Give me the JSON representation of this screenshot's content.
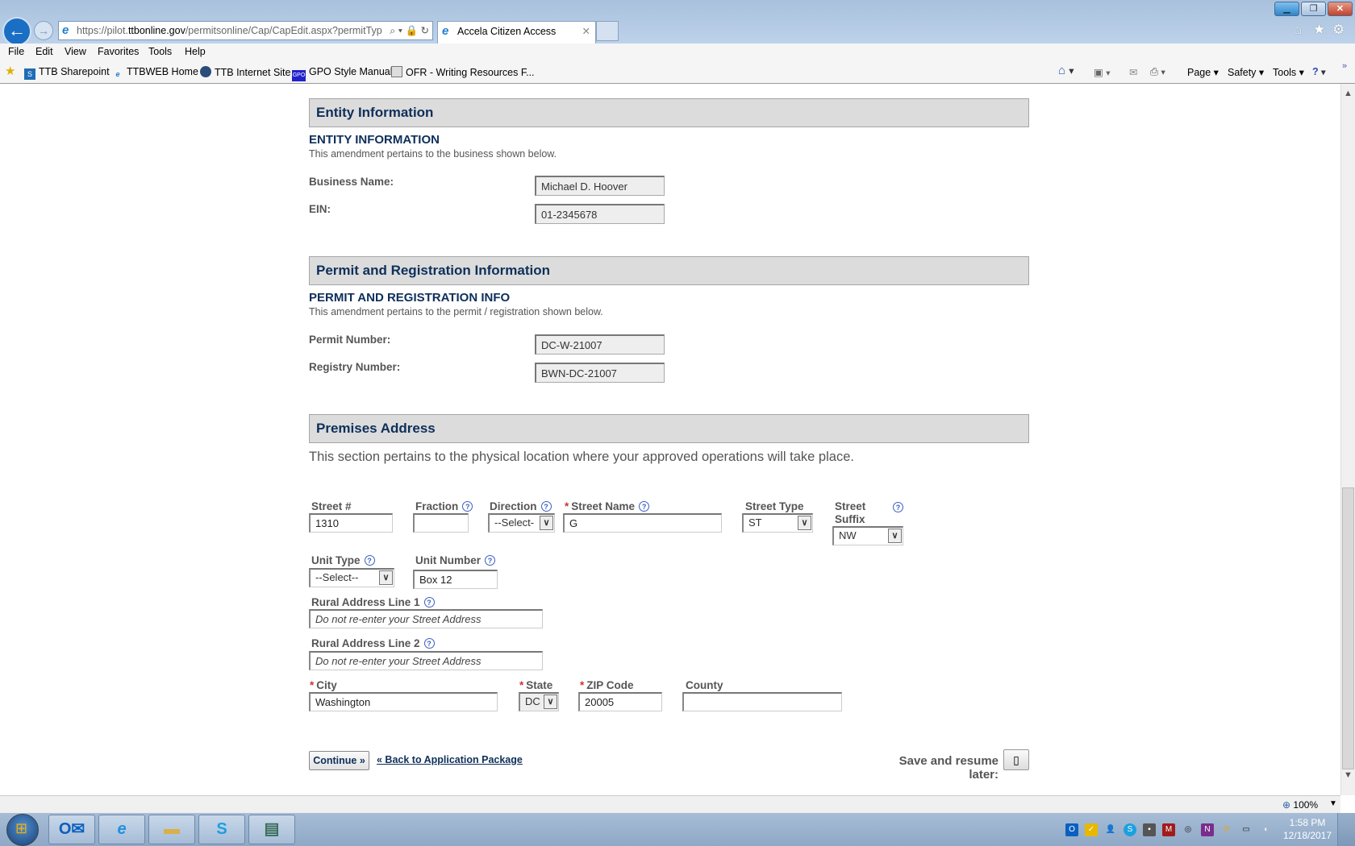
{
  "browser": {
    "url_host_prefix": "https://pilot.",
    "url_host": "ttbonline.gov",
    "url_path": "/permitsonline/Cap/CapEdit.aspx?permitTyp",
    "tab_title": "Accela Citizen Access",
    "menu": [
      "File",
      "Edit",
      "View",
      "Favorites",
      "Tools",
      "Help"
    ],
    "favorites": [
      "TTB Sharepoint",
      "TTBWEB Home",
      "TTB Internet Site",
      "GPO Style Manual",
      "OFR - Writing Resources F..."
    ],
    "command_bar": [
      "Page ▾",
      "Safety ▾",
      "Tools ▾"
    ],
    "zoom": "100%"
  },
  "entity": {
    "header": "Entity Information",
    "subheader": "ENTITY INFORMATION",
    "description": "This amendment pertains to the business shown below.",
    "business_name_label": "Business Name:",
    "business_name": "Michael D. Hoover",
    "ein_label": "EIN:",
    "ein": "01-2345678"
  },
  "permit": {
    "header": "Permit and Registration Information",
    "subheader": "PERMIT AND REGISTRATION INFO",
    "description": "This amendment pertains to the permit / registration shown below.",
    "permit_number_label": "Permit Number:",
    "permit_number": "DC-W-21007",
    "registry_number_label": "Registry Number:",
    "registry_number": "BWN-DC-21007"
  },
  "premises": {
    "header": "Premises Address",
    "description": "This section pertains to the physical location where your approved operations will take place.",
    "required_mark": "*",
    "help": "?",
    "street_no_label": "Street #",
    "street_no": "1310",
    "fraction_label": "Fraction",
    "fraction": "",
    "direction_label": "Direction",
    "direction": "--Select-",
    "street_name_label": "Street Name",
    "street_name": "G",
    "street_type_label": "Street Type",
    "street_type": "ST",
    "street_suffix_label_1": "Street",
    "street_suffix_label_2": "Suffix",
    "street_suffix": "NW",
    "unit_type_label": "Unit Type",
    "unit_type": "--Select--",
    "unit_number_label": "Unit Number",
    "unit_number": "Box 12",
    "rural1_label": "Rural Address Line 1",
    "rural1_placeholder": "Do not re-enter your Street Address",
    "rural2_label": "Rural Address Line 2",
    "rural2_placeholder": "Do not re-enter your Street Address",
    "city_label": "City",
    "city": "Washington",
    "state_label": "State",
    "state": "DC",
    "zip_label": "ZIP Code",
    "zip": "20005",
    "county_label": "County",
    "county": ""
  },
  "actions": {
    "continue": "Continue »",
    "back": "« Back to Application Package",
    "save_resume": "Save and resume later:"
  },
  "taskbar": {
    "time": "1:58 PM",
    "date": "12/18/2017"
  }
}
